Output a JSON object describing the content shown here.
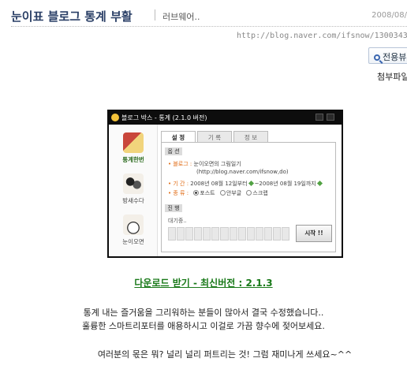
{
  "post": {
    "title": "눈이표 블로그 통계 부활",
    "category": "러브웨어..",
    "date": "2008/08/",
    "url": "http://blog.naver.com/ifsnow/130034398",
    "view_button": "전용뷰",
    "attachment_label": "첨부파일"
  },
  "app": {
    "window_title": "블로그 박스 - 통계 (2.1.0 버전)",
    "sidebar": [
      {
        "label": "통계한번",
        "icon": "stats-book-icon",
        "active": true
      },
      {
        "label": "방새수다",
        "icon": "chat-people-icon",
        "active": false
      },
      {
        "label": "눈이오면",
        "icon": "snowman-icon",
        "active": false
      }
    ],
    "tabs": [
      {
        "label": "설 정",
        "active": true
      },
      {
        "label": "기 록",
        "active": false
      },
      {
        "label": "정 보",
        "active": false
      }
    ],
    "options_section": "옵 션",
    "blog_key": "블로그",
    "blog_value": "눈이오면의 그림일기",
    "blog_url": "(http://blog.naver.com/ifsnow,do)",
    "period_key": "기 간",
    "period_from": "2008년 08월 12일부터",
    "period_to": "~2008년 08월 19일까지",
    "type_key": "종 류",
    "type_options": [
      {
        "label": "포스트",
        "selected": true
      },
      {
        "label": "안부글",
        "selected": false
      },
      {
        "label": "스크랩",
        "selected": false
      }
    ],
    "progress_section": "진 행",
    "progress_status": "대기중..",
    "progress": 0,
    "start_button": "시작 !!"
  },
  "content": {
    "download_link": "다운로드 받기 - 최신버전 : 2.1.3",
    "lines": [
      "통계 내는 즐거움을 그리워하는 분들이 많아서 결국 수정했습니다..",
      "훌륭한 스마트리포터를 애용하시고 이걸로 가끔 향수에 젖어보세요.",
      "",
      "여러분의 몫은 뭐? 널리 널리 퍼트리는 것! 그럼 재미나게 쓰세요~^^"
    ]
  },
  "colors": {
    "title": "#2a3f66",
    "link_green": "#1a7a1a",
    "accent_orange": "#e06a12",
    "window_frame": "#0c0c0c"
  }
}
